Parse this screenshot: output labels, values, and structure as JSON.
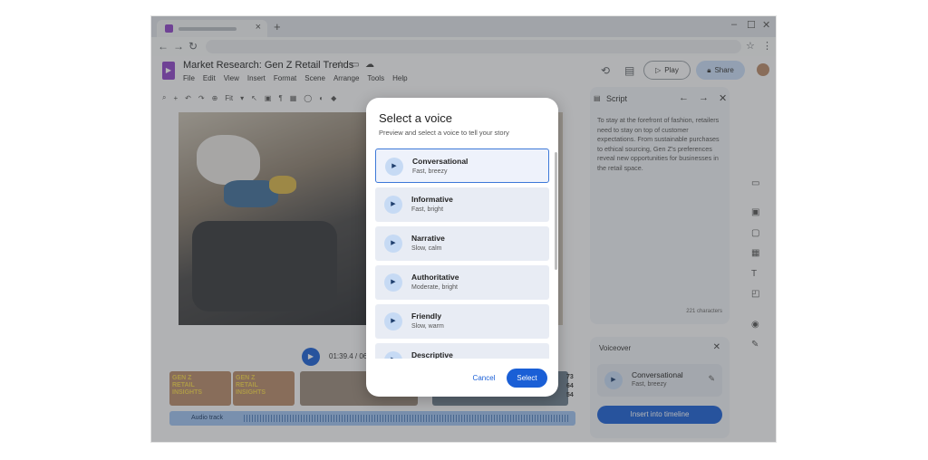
{
  "browser": {
    "new_tab_symbol": "+",
    "tab_close_symbol": "×"
  },
  "app": {
    "doc_title": "Market Research: Gen Z Retail Trends",
    "menu": [
      "File",
      "Edit",
      "View",
      "Insert",
      "Format",
      "Scene",
      "Arrange",
      "Tools",
      "Help"
    ],
    "play_label": "Play",
    "share_label": "Share",
    "zoom_label": "Fit"
  },
  "player": {
    "time": "01:39.4 / 06"
  },
  "timeline": {
    "thumb_text": "GEN Z RETAIL INSIGHTS",
    "side_numbers": [
      "73",
      "64",
      "54"
    ],
    "audio_label": "Audio track"
  },
  "script_panel": {
    "title": "Script",
    "text": "To stay at the forefront of fashion, retailers need to stay on top of customer expectations. From sustainable purchases to ethical sourcing, Gen Z's preferences reveal new opportunities for businesses in the retail space.",
    "char_count": "221 characters"
  },
  "voiceover_panel": {
    "title": "Voiceover",
    "voice_name": "Conversational",
    "voice_desc": "Fast, breezy",
    "insert_label": "Insert into timeline"
  },
  "dialog": {
    "title": "Select a voice",
    "subtitle": "Preview and select a voice to tell your story",
    "voices": [
      {
        "name": "Conversational",
        "desc": "Fast, breezy"
      },
      {
        "name": "Informative",
        "desc": "Fast, bright"
      },
      {
        "name": "Narrative",
        "desc": "Slow, calm"
      },
      {
        "name": "Authoritative",
        "desc": "Moderate, bright"
      },
      {
        "name": "Friendly",
        "desc": "Slow, warm"
      },
      {
        "name": "Descriptive",
        "desc": ""
      }
    ],
    "selected_voice": "Conversational",
    "cancel_label": "Cancel",
    "select_label": "Select"
  },
  "colors": {
    "accent": "#1a5fd6",
    "brand": "#8e44c9",
    "scrim": "rgba(60,64,67,0.38)"
  }
}
